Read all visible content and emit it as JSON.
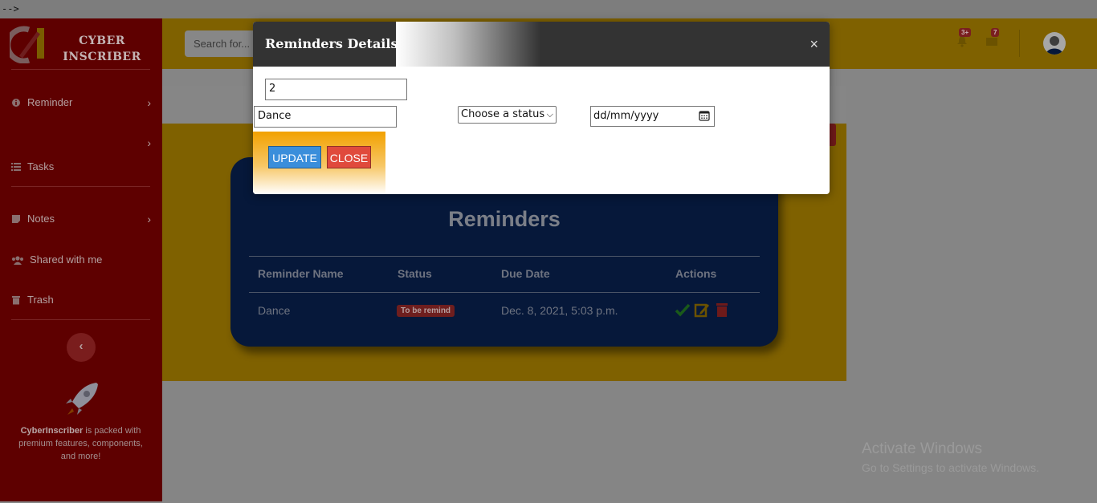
{
  "stray_text": "-->",
  "brand": {
    "line1": "CYBER",
    "line2": "INSCRIBER"
  },
  "sidebar": {
    "items": [
      {
        "label": "Reminder",
        "icon": "info-circle-icon",
        "has_chevron": true
      },
      {
        "label": "",
        "icon": "",
        "has_chevron": true
      },
      {
        "label": "Tasks",
        "icon": "list-icon",
        "has_chevron": false
      },
      {
        "label": "Notes",
        "icon": "note-icon",
        "has_chevron": true
      },
      {
        "label": "Shared with me",
        "icon": "users-icon",
        "has_chevron": false
      },
      {
        "label": "Trash",
        "icon": "trash-icon",
        "has_chevron": false
      }
    ],
    "toggle_icon": "chevron-left-icon",
    "promo_brand": "CyberInscriber",
    "promo_text": " is packed with premium features, components, and more!"
  },
  "topbar": {
    "search_placeholder": "Search for...",
    "alerts_badge": "3+",
    "messages_badge": "7"
  },
  "reminders": {
    "title": "Reminders",
    "columns": [
      "Reminder Name",
      "Status",
      "Due Date",
      "Actions"
    ],
    "rows": [
      {
        "name": "Dance",
        "status": "To be remind",
        "due": "Dec. 8, 2021, 5:03 p.m."
      }
    ]
  },
  "modal": {
    "title": "Reminders Details",
    "id_value": "2",
    "name_value": "Dance",
    "status_selected": "Choose a status",
    "date_placeholder": "dd/mm/yyyy",
    "update_label": "UPDATE",
    "close_label": "CLOSE",
    "close_icon": "×"
  },
  "watermark": {
    "line1": "Activate Windows",
    "line2": "Go to Settings to activate Windows."
  },
  "colors": {
    "sidebar": "#5e0000",
    "topbar": "#7f6100",
    "card": "#06183a",
    "update_button": "#3a8edb",
    "close_button": "#e04a3c"
  }
}
